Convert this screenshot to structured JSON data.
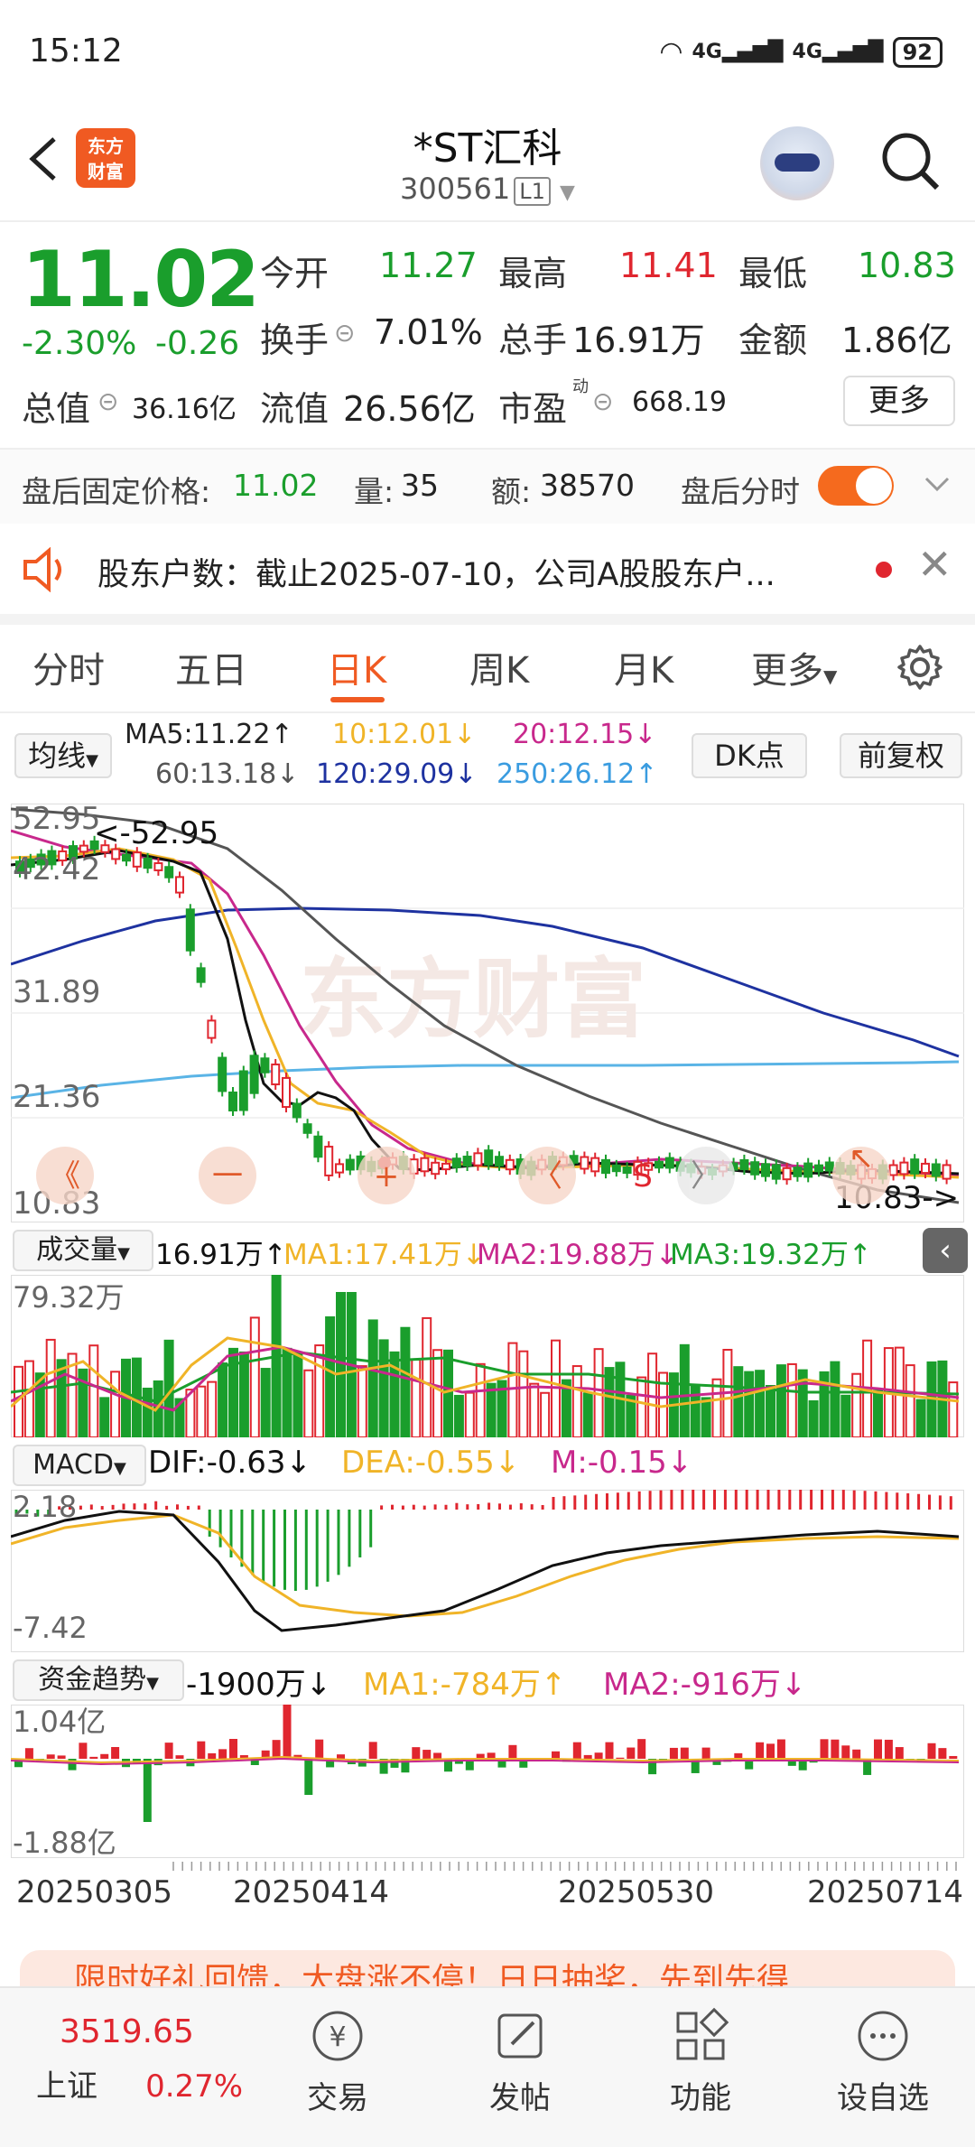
{
  "status_bar": {
    "time": "15:12",
    "network": "4G 4G",
    "battery": "92"
  },
  "header": {
    "logo_text": "东方\n财富",
    "title": "*ST汇科",
    "code": "300561",
    "level": "L1"
  },
  "quote": {
    "price": "11.02",
    "change_pct": "-2.30%",
    "change": "-0.26",
    "open_label": "今开",
    "open": "11.27",
    "high_label": "最高",
    "high": "11.41",
    "low_label": "最低",
    "low": "10.83",
    "turnover_label": "换手",
    "turnover": "7.01%",
    "volume_label": "总手",
    "volume": "16.91万",
    "amount_label": "金额",
    "amount": "1.86亿",
    "mktcap_label": "总值",
    "mktcap": "36.16亿",
    "float_label": "流值",
    "float_cap": "26.56亿",
    "pe_label": "市盈",
    "pe_sup": "动",
    "pe": "668.19",
    "more_button": "更多"
  },
  "after_hours": {
    "price_label": "盘后固定价格:",
    "price": "11.02",
    "vol_label": "量:",
    "vol": "35",
    "amt_label": "额:",
    "amt": "38570",
    "switch_label": "盘后分时"
  },
  "notice": {
    "text": "股东户数：截止2025-07-10，公司A股股东户..."
  },
  "tabs": [
    {
      "label": "分时"
    },
    {
      "label": "五日"
    },
    {
      "label": "日K"
    },
    {
      "label": "周K"
    },
    {
      "label": "月K"
    },
    {
      "label": "更多"
    }
  ],
  "ma_row": {
    "select_label": "均线",
    "ma5": "MA5:11.22↑",
    "ma10": "10:12.01↓",
    "ma20": "20:12.15↓",
    "ma60": "60:13.18↓",
    "ma120": "120:29.09↓",
    "ma250": "250:26.12↑",
    "dk_button": "DK点",
    "adjust_button": "前复权",
    "colors": {
      "ma5": "#222222",
      "ma10": "#f0b428",
      "ma20": "#c8288c",
      "ma60": "#555555",
      "ma120": "#1e32a0",
      "ma250": "#5ab4e6"
    }
  },
  "main_chart": {
    "y_ticks": [
      "52.95",
      "42.42",
      "31.89",
      "21.36",
      "10.83"
    ],
    "max_annotation": "<-52.95",
    "min_annotation": "10.83->",
    "watermark": "东方财富",
    "controls": [
      "《",
      "一",
      "+",
      "〈",
      "S",
      "〉",
      "↖"
    ]
  },
  "volume": {
    "select_label": "成交量",
    "value": "16.91万↑",
    "ma1": "MA1:17.41万↓",
    "ma2": "MA2:19.88万↓",
    "ma3": "MA3:19.32万↑",
    "y_max": "79.32万"
  },
  "macd": {
    "select_label": "MACD",
    "dif": "DIF:-0.63↓",
    "dea": "DEA:-0.55↓",
    "m": "M:-0.15↓",
    "y_top": "2.18",
    "y_bottom": "-7.42"
  },
  "fund_trend": {
    "select_label": "资金趋势",
    "value": "-1900万↓",
    "ma1": "MA1:-784万↑",
    "ma2": "MA2:-916万↓",
    "y_top": "1.04亿",
    "y_bottom": "-1.88亿"
  },
  "dates": [
    "20250305",
    "20250414",
    "20250530",
    "20250714"
  ],
  "promo": {
    "text": "限时好礼回馈，大盘涨不停！日日抽奖，先到先得"
  },
  "bottom_nav": {
    "index_value": "3519.65",
    "index_name": "上证",
    "index_change": "0.27%",
    "items": [
      {
        "label": "交易"
      },
      {
        "label": "发帖"
      },
      {
        "label": "功能"
      },
      {
        "label": "设自选"
      }
    ]
  }
}
